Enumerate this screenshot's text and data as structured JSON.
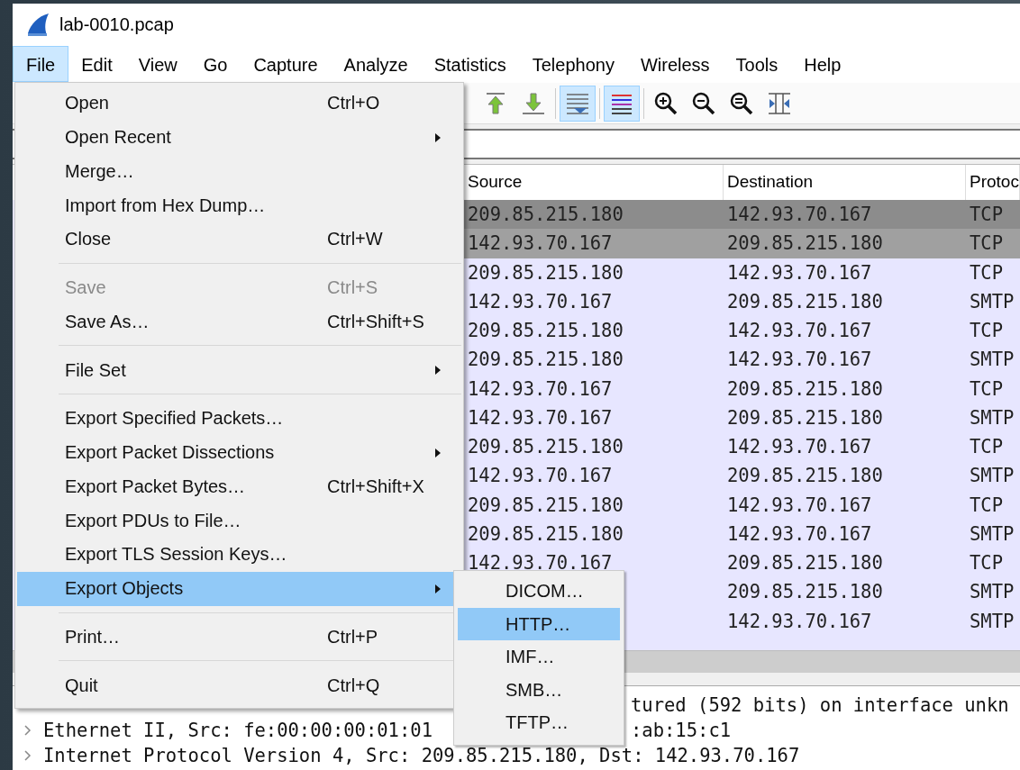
{
  "window": {
    "title": "lab-0010.pcap"
  },
  "menubar": [
    {
      "label": "File",
      "selected": true
    },
    {
      "label": "Edit",
      "selected": false
    },
    {
      "label": "View",
      "selected": false
    },
    {
      "label": "Go",
      "selected": false
    },
    {
      "label": "Capture",
      "selected": false
    },
    {
      "label": "Analyze",
      "selected": false
    },
    {
      "label": "Statistics",
      "selected": false
    },
    {
      "label": "Telephony",
      "selected": false
    },
    {
      "label": "Wireless",
      "selected": false
    },
    {
      "label": "Tools",
      "selected": false
    },
    {
      "label": "Help",
      "selected": false
    }
  ],
  "toolbar": [
    {
      "kind": "go-first",
      "selected": false
    },
    {
      "kind": "go-last",
      "selected": false
    },
    {
      "kind": "separator"
    },
    {
      "kind": "autoscroll",
      "selected": true
    },
    {
      "kind": "separator"
    },
    {
      "kind": "colorize",
      "selected": true
    },
    {
      "kind": "separator"
    },
    {
      "kind": "zoom-in",
      "selected": false
    },
    {
      "kind": "zoom-out",
      "selected": false
    },
    {
      "kind": "zoom-reset",
      "selected": false
    },
    {
      "kind": "resize-columns",
      "selected": false
    }
  ],
  "packet_list": {
    "columns": [
      "Source",
      "Destination",
      "Protoc"
    ],
    "rows": [
      {
        "source": "209.85.215.180",
        "destination": "142.93.70.167",
        "protocol": "TCP",
        "color": "#8c8c8c"
      },
      {
        "source": "142.93.70.167",
        "destination": "209.85.215.180",
        "protocol": "TCP",
        "color": "#a0a0a0"
      },
      {
        "source": "209.85.215.180",
        "destination": "142.93.70.167",
        "protocol": "TCP",
        "color": "#e7e6ff"
      },
      {
        "source": "142.93.70.167",
        "destination": "209.85.215.180",
        "protocol": "SMTP",
        "color": "#e7e6ff"
      },
      {
        "source": "209.85.215.180",
        "destination": "142.93.70.167",
        "protocol": "TCP",
        "color": "#e7e6ff"
      },
      {
        "source": "209.85.215.180",
        "destination": "142.93.70.167",
        "protocol": "SMTP",
        "color": "#e7e6ff"
      },
      {
        "source": "142.93.70.167",
        "destination": "209.85.215.180",
        "protocol": "TCP",
        "color": "#e7e6ff"
      },
      {
        "source": "142.93.70.167",
        "destination": "209.85.215.180",
        "protocol": "SMTP",
        "color": "#e7e6ff"
      },
      {
        "source": "209.85.215.180",
        "destination": "142.93.70.167",
        "protocol": "TCP",
        "color": "#e7e6ff"
      },
      {
        "source": "142.93.70.167",
        "destination": "209.85.215.180",
        "protocol": "SMTP",
        "color": "#e7e6ff"
      },
      {
        "source": "209.85.215.180",
        "destination": "142.93.70.167",
        "protocol": "TCP",
        "color": "#e7e6ff"
      },
      {
        "source": "209.85.215.180",
        "destination": "142.93.70.167",
        "protocol": "SMTP",
        "color": "#e7e6ff"
      },
      {
        "source": "142.93.70.167",
        "destination": "209.85.215.180",
        "protocol": "TCP",
        "color": "#e7e6ff"
      },
      {
        "destination": "209.85.215.180",
        "protocol": "SMTP",
        "color": "#e7e6ff"
      },
      {
        "destination": "142.93.70.167",
        "protocol": "SMTP",
        "color": "#e7e6ff"
      }
    ]
  },
  "details": [
    {
      "text_after_menu": "tured (592 bits) on interface unkn"
    },
    {
      "expanded": false,
      "text": "Ethernet II, Src: fe:00:00:00:01:01",
      "text_after_menu": ":ab:15:c1"
    },
    {
      "expanded": false,
      "text": "Internet Protocol Version 4, Src: 209.85.215.180, Dst: 142.93.70.167"
    }
  ],
  "file_menu": {
    "items": [
      {
        "kind": "item",
        "label": "Open",
        "shortcut": "Ctrl+O",
        "submenu": false,
        "disabled": false,
        "selected": false
      },
      {
        "kind": "item",
        "label": "Open Recent",
        "submenu": true,
        "disabled": false,
        "selected": false
      },
      {
        "kind": "item",
        "label": "Merge…",
        "submenu": false,
        "disabled": false,
        "selected": false
      },
      {
        "kind": "item",
        "label": "Import from Hex Dump…",
        "submenu": false,
        "disabled": false,
        "selected": false
      },
      {
        "kind": "item",
        "label": "Close",
        "shortcut": "Ctrl+W",
        "submenu": false,
        "disabled": false,
        "selected": false
      },
      {
        "kind": "separator"
      },
      {
        "kind": "item",
        "label": "Save",
        "shortcut": "Ctrl+S",
        "submenu": false,
        "disabled": true,
        "selected": false
      },
      {
        "kind": "item",
        "label": "Save As…",
        "shortcut": "Ctrl+Shift+S",
        "submenu": false,
        "disabled": false,
        "selected": false
      },
      {
        "kind": "separator"
      },
      {
        "kind": "item",
        "label": "File Set",
        "submenu": true,
        "disabled": false,
        "selected": false
      },
      {
        "kind": "separator"
      },
      {
        "kind": "item",
        "label": "Export Specified Packets…",
        "submenu": false,
        "disabled": false,
        "selected": false
      },
      {
        "kind": "item",
        "label": "Export Packet Dissections",
        "submenu": true,
        "disabled": false,
        "selected": false
      },
      {
        "kind": "item",
        "label": "Export Packet Bytes…",
        "shortcut": "Ctrl+Shift+X",
        "submenu": false,
        "disabled": false,
        "selected": false
      },
      {
        "kind": "item",
        "label": "Export PDUs to File…",
        "submenu": false,
        "disabled": false,
        "selected": false
      },
      {
        "kind": "item",
        "label": "Export TLS Session Keys…",
        "submenu": false,
        "disabled": false,
        "selected": false
      },
      {
        "kind": "item",
        "label": "Export Objects",
        "submenu": true,
        "disabled": false,
        "selected": true
      },
      {
        "kind": "separator"
      },
      {
        "kind": "item",
        "label": "Print…",
        "shortcut": "Ctrl+P",
        "submenu": false,
        "disabled": false,
        "selected": false
      },
      {
        "kind": "separator"
      },
      {
        "kind": "item",
        "label": "Quit",
        "shortcut": "Ctrl+Q",
        "submenu": false,
        "disabled": false,
        "selected": false
      }
    ]
  },
  "export_objects_menu": {
    "items": [
      {
        "label": "DICOM…",
        "selected": false
      },
      {
        "label": "HTTP…",
        "selected": true
      },
      {
        "label": "IMF…",
        "selected": false
      },
      {
        "label": "SMB…",
        "selected": false
      },
      {
        "label": "TFTP…",
        "selected": false
      }
    ]
  }
}
